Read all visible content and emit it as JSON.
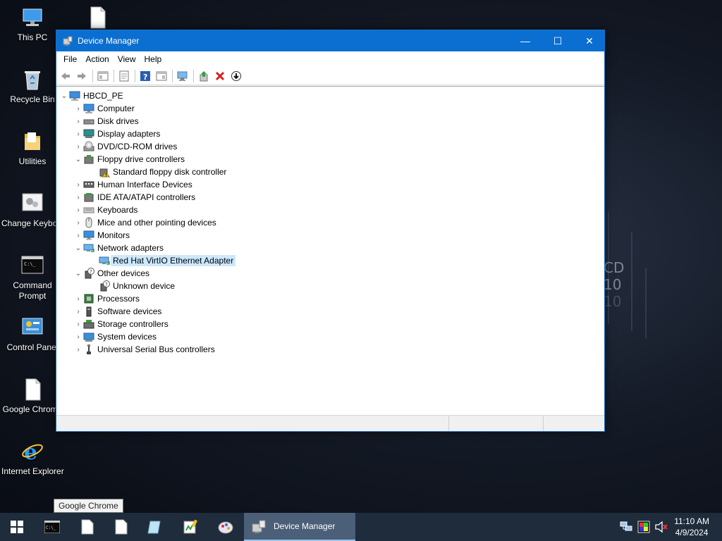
{
  "desktop": {
    "background_text": [
      "CD",
      "10",
      "10"
    ],
    "icons": [
      {
        "label": "This PC",
        "icon": "this-pc-icon"
      },
      {
        "label": "",
        "icon": "blank-file-icon"
      },
      {
        "label": "Recycle Bin",
        "icon": "recycle-bin-icon"
      },
      {
        "label": "Utilities",
        "icon": "folder-icon"
      },
      {
        "label": "Change Keyboard Layo",
        "icon": "keyboard-settings-icon"
      },
      {
        "label": "Command Prompt",
        "icon": "command-prompt-icon"
      },
      {
        "label": "Control Panel",
        "icon": "control-panel-icon"
      },
      {
        "label": "Google Chrome",
        "icon": "blank-file-icon"
      },
      {
        "label": "Internet Explorer",
        "icon": "internet-explorer-icon"
      }
    ]
  },
  "window": {
    "title": "Device Manager",
    "minimize": "—",
    "maximize": "☐",
    "close": "✕",
    "menu": [
      "File",
      "Action",
      "View",
      "Help"
    ],
    "toolbar_icons": [
      "back-arrow-icon",
      "forward-arrow-icon",
      "show-hide-console-tree-icon",
      "properties-icon",
      "help-icon",
      "show-action-pane-icon",
      "scan-hardware-icon",
      "update-driver-icon",
      "uninstall-device-icon",
      "disable-device-icon"
    ],
    "tree": {
      "root": "HBCD_PE",
      "nodes": [
        {
          "label": "Computer",
          "expanded": false,
          "icon": "computer-icon",
          "children": []
        },
        {
          "label": "Disk drives",
          "expanded": false,
          "icon": "disk-drive-icon",
          "children": []
        },
        {
          "label": "Display adapters",
          "expanded": false,
          "icon": "display-adapter-icon",
          "children": []
        },
        {
          "label": "DVD/CD-ROM drives",
          "expanded": false,
          "icon": "dvd-drive-icon",
          "children": []
        },
        {
          "label": "Floppy drive controllers",
          "expanded": true,
          "icon": "floppy-controller-icon",
          "children": [
            {
              "label": "Standard floppy disk controller",
              "icon": "warning-device-icon",
              "selected": false
            }
          ]
        },
        {
          "label": "Human Interface Devices",
          "expanded": false,
          "icon": "hid-icon",
          "children": []
        },
        {
          "label": "IDE ATA/ATAPI controllers",
          "expanded": false,
          "icon": "ide-controller-icon",
          "children": []
        },
        {
          "label": "Keyboards",
          "expanded": false,
          "icon": "keyboard-icon",
          "children": []
        },
        {
          "label": "Mice and other pointing devices",
          "expanded": false,
          "icon": "mouse-icon",
          "children": []
        },
        {
          "label": "Monitors",
          "expanded": false,
          "icon": "monitor-icon",
          "children": []
        },
        {
          "label": "Network adapters",
          "expanded": true,
          "icon": "network-adapter-icon",
          "children": [
            {
              "label": "Red Hat VirtIO Ethernet Adapter",
              "icon": "network-adapter-icon",
              "selected": true
            }
          ]
        },
        {
          "label": "Other devices",
          "expanded": true,
          "icon": "unknown-device-icon",
          "children": [
            {
              "label": "Unknown device",
              "icon": "unknown-device-icon",
              "selected": false
            }
          ]
        },
        {
          "label": "Processors",
          "expanded": false,
          "icon": "processor-icon",
          "children": []
        },
        {
          "label": "Software devices",
          "expanded": false,
          "icon": "software-device-icon",
          "children": []
        },
        {
          "label": "Storage controllers",
          "expanded": false,
          "icon": "storage-controller-icon",
          "children": []
        },
        {
          "label": "System devices",
          "expanded": false,
          "icon": "system-device-icon",
          "children": []
        },
        {
          "label": "Universal Serial Bus controllers",
          "expanded": false,
          "icon": "usb-icon",
          "children": []
        }
      ]
    }
  },
  "taskbar": {
    "tooltip": "Google Chrome",
    "items": [
      "start-icon",
      "command-prompt-icon",
      "blank-file-icon",
      "blank-file-icon",
      "notepad-icon",
      "editor-icon",
      "paint-icon"
    ],
    "active_label": "Device Manager",
    "tray_icons": [
      "network-icon",
      "display-color-icon",
      "volume-muted-icon"
    ],
    "time": "11:10 AM",
    "date": "4/9/2024"
  },
  "colors": {
    "titlebar": "#0a6fd1",
    "selection": "#cce8ff",
    "taskbar": "#1e2c3c",
    "taskbar_active": "#4b5f78"
  }
}
